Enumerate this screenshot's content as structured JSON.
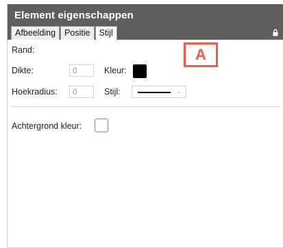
{
  "panel": {
    "title": "Element eigenschappen",
    "tabs": [
      {
        "label": "Afbeelding",
        "active": false
      },
      {
        "label": "Positie",
        "active": false
      },
      {
        "label": "Stijl",
        "active": true
      }
    ],
    "lock_icon": "lock-icon"
  },
  "border": {
    "section_label": "Rand:",
    "thickness_label": "Dikte:",
    "thickness_value": "0",
    "color_label": "Kleur:",
    "color_value": "#000000",
    "radius_label": "Hoekradius:",
    "radius_value": "0",
    "style_label": "Stijl:",
    "style_selected": "solid-line"
  },
  "background": {
    "label": "Achtergrond kleur:",
    "color_value": "none"
  },
  "annotation": {
    "letter": "A",
    "color": "#f05a4a"
  }
}
